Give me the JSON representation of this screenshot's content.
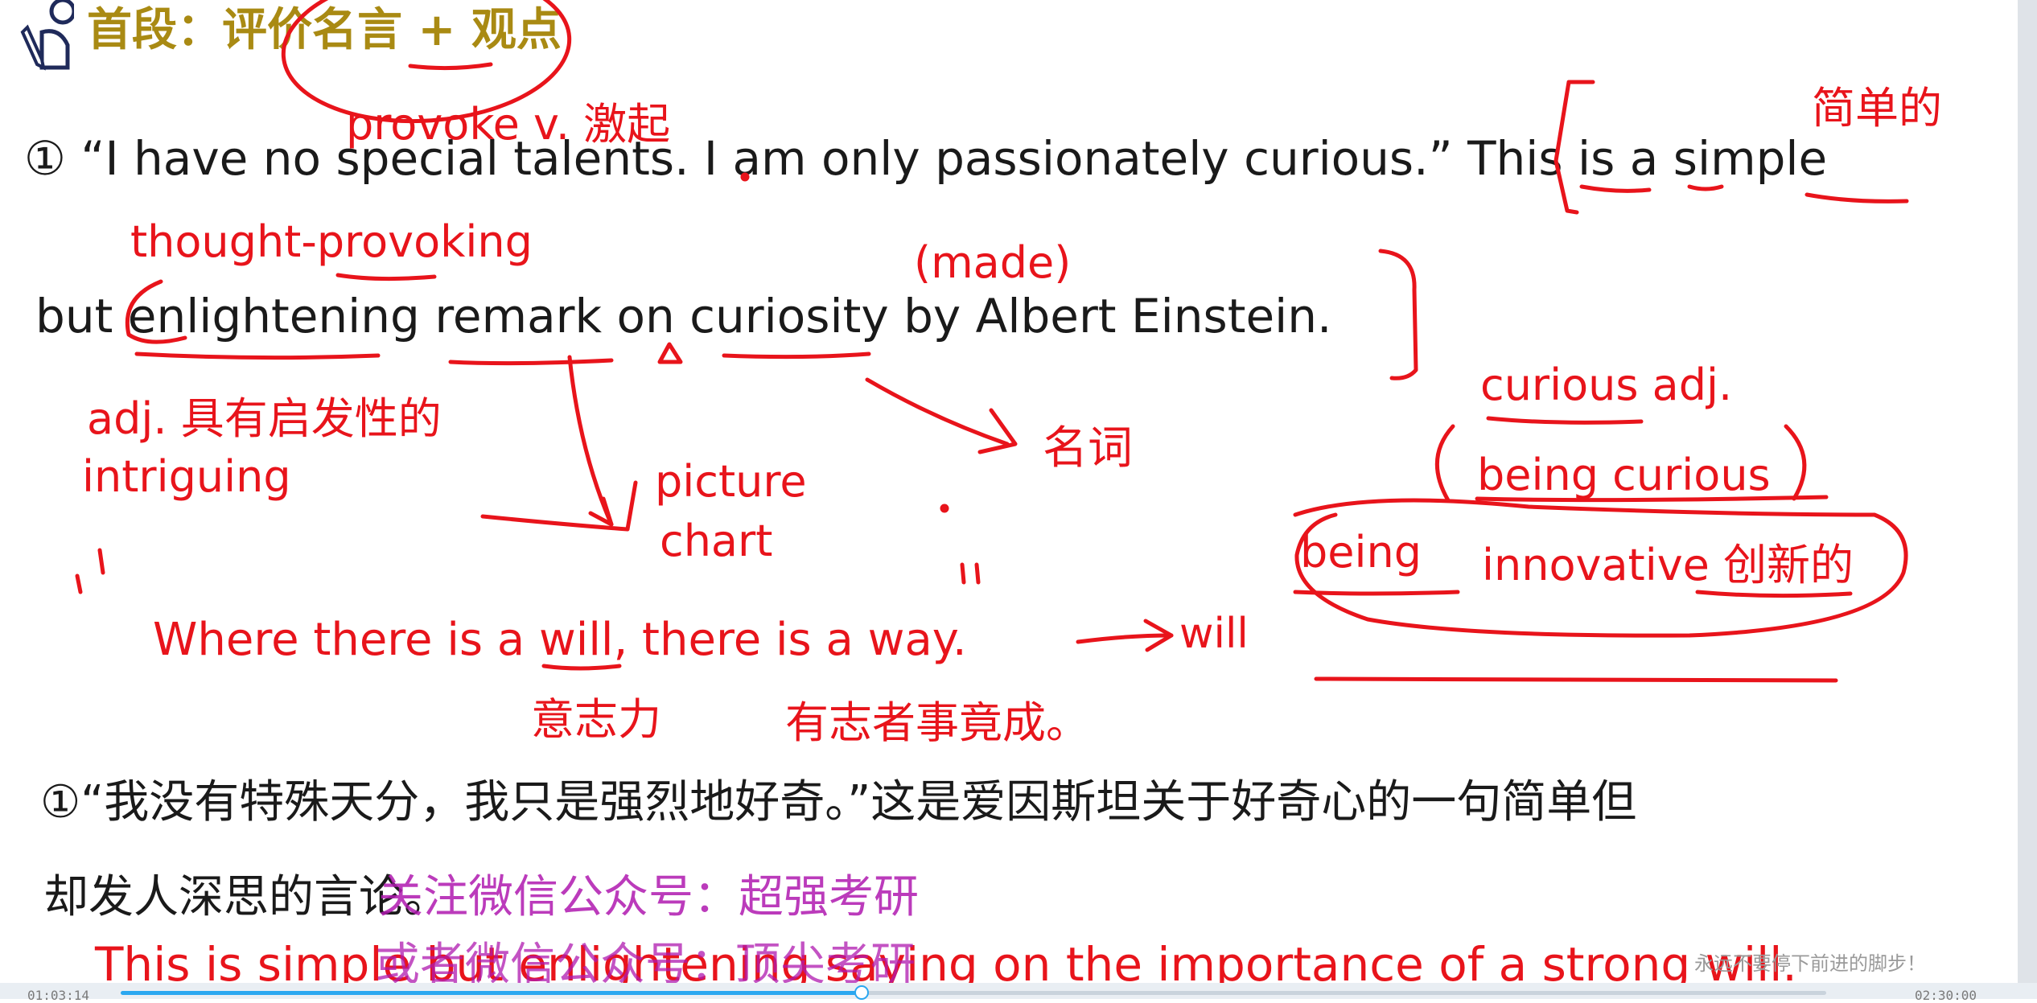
{
  "header": {
    "title": "首段：评价名言 + 观点",
    "icon": "reader-study-icon"
  },
  "sentence_en": {
    "line1": "① “I have no special talents. I am only passionately curious.” This is a simple",
    "line2": "but enlightening remark on curiosity by Albert Einstein."
  },
  "annotations": {
    "provoke": "provoke v. 激起",
    "jiandan": "简单的",
    "thought_provoking": "thought-provoking",
    "made": "(made)",
    "adj_def": "adj. 具有启发性的",
    "intriguing": "intriguing",
    "picture": "picture",
    "chart": "chart",
    "mingci": "名词",
    "curious_adj": "curious adj.",
    "being_curious": "being curious",
    "being": "being",
    "innovative": "innovative 创新的",
    "quote": "Where there is a will, there is a way.",
    "will": "will",
    "yizhili": "意志力",
    "youzhi": "有志者事竟成。"
  },
  "sentence_cn": {
    "line1": "①“我没有特殊天分，我只是强烈地好奇。”这是爱因斯坦关于好奇心的一句简单但",
    "line2": "却发人深思的言论。"
  },
  "bottom_line": "This is simple but enlightening saying on the importance of a strong will.",
  "watermark": {
    "line1": "关注微信公众号：超强考研",
    "line2": "或者微信公众号：顶尖考研"
  },
  "player": {
    "caption": "永远不要停下前进的脚步！",
    "time_current": "01:03:14",
    "time_total": "02:30:00"
  },
  "colors": {
    "ink": "#e8141b",
    "title": "#a98a13",
    "watermark": "#b01ab0",
    "progress": "#2aa7f0"
  }
}
